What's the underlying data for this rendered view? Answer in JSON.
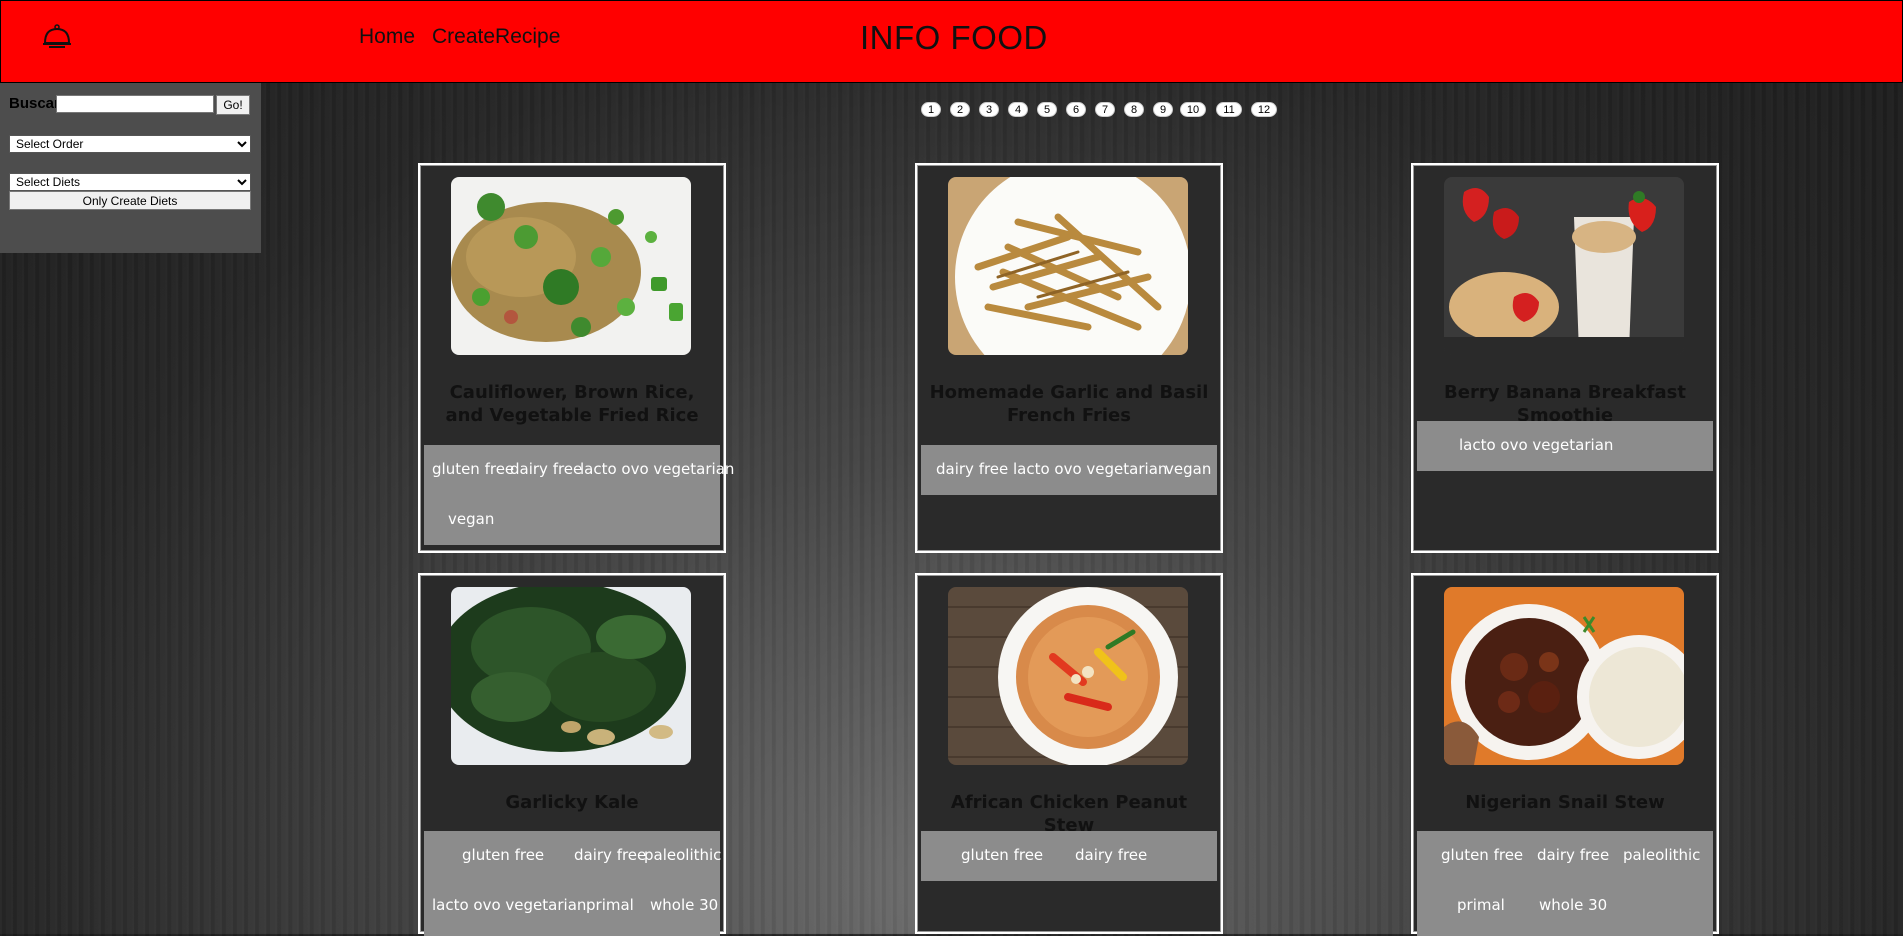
{
  "header": {
    "nav": [
      "Home",
      "CreateRecipe"
    ],
    "brand": "INFO FOOD",
    "icon": "food-cloche-icon",
    "bg_color": "#ff0000"
  },
  "sidebar": {
    "search_label": "Buscar",
    "search_value": "",
    "go_label": "Go!",
    "order_select": "Select Order",
    "diets_select": "Select Diets",
    "create_button": "Only Create Diets"
  },
  "pagination": [
    "1",
    "2",
    "3",
    "4",
    "5",
    "6",
    "7",
    "8",
    "9",
    "10",
    "11",
    "12"
  ],
  "recipes": [
    {
      "title": "Cauliflower, Brown Rice, and Vegetable Fried Rice",
      "diets": [
        "gluten free",
        "dairy free",
        "lacto ovo vegetarian",
        "vegan"
      ]
    },
    {
      "title": "Homemade Garlic and Basil French Fries",
      "diets": [
        "dairy free",
        "lacto ovo vegetarian",
        "vegan"
      ]
    },
    {
      "title": "Berry Banana Breakfast Smoothie",
      "diets": [
        "lacto ovo vegetarian"
      ]
    },
    {
      "title": "Garlicky Kale",
      "diets": [
        "gluten free",
        "dairy free",
        "paleolithic",
        "lacto ovo vegetarian",
        "primal",
        "whole 30"
      ]
    },
    {
      "title": "African Chicken Peanut Stew",
      "diets": [
        "gluten free",
        "dairy free"
      ]
    },
    {
      "title": "Nigerian Snail Stew",
      "diets": [
        "gluten free",
        "dairy free",
        "paleolithic",
        "primal",
        "whole 30"
      ]
    }
  ]
}
